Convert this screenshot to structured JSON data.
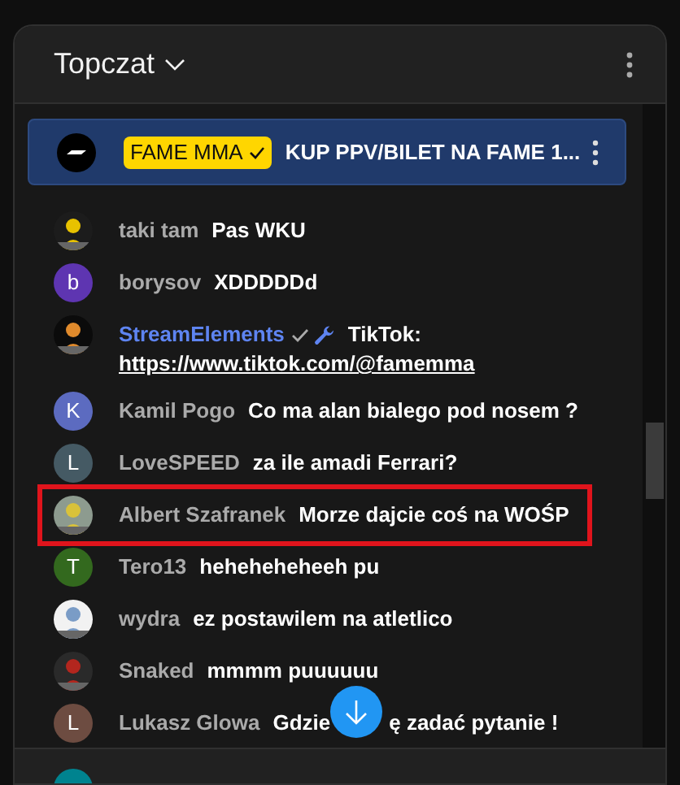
{
  "header": {
    "title": "Topczat"
  },
  "pinned": {
    "author": "FAME MMA",
    "verified": true,
    "text": "KUP PPV/BILET NA FAME 1..."
  },
  "messages": [
    {
      "author": "taki tam",
      "text": "Pas WKU"
    },
    {
      "author": "borysov",
      "text": "XDDDDDd",
      "avatar": {
        "kind": "letter",
        "letter": "b",
        "color": "#5e35b1"
      }
    },
    {
      "author": "StreamElements",
      "moderator": true,
      "verified": true,
      "text": "TikTok: ",
      "link": "https://www.tiktok.com/@famemma"
    },
    {
      "author": "Kamil Pogo",
      "text": "Co ma alan bialego pod nosem ?",
      "avatar": {
        "kind": "letter",
        "letter": "K",
        "color": "#5c6bc0"
      }
    },
    {
      "author": "LoveSPEED",
      "text": "za ile amadi Ferrari?",
      "avatar": {
        "kind": "letter",
        "letter": "L",
        "color": "#455a64"
      }
    },
    {
      "author": "Albert Szafranek",
      "text": "Morze dajcie coś na WOŚP",
      "highlighted": true
    },
    {
      "author": "Tero13",
      "text": "heheheheheeh pu",
      "avatar": {
        "kind": "letter",
        "letter": "T",
        "color": "#33691e"
      }
    },
    {
      "author": "wydra",
      "text": "ez postawilem na atletlico"
    },
    {
      "author": "Snaked",
      "text": "mmmm puuuuuu"
    },
    {
      "author": "Lukasz Glowa",
      "text_parts": [
        "Gdzie",
        "ę zadać pytanie !"
      ],
      "avatar": {
        "kind": "letter",
        "letter": "L",
        "color": "#6d4c41"
      }
    }
  ]
}
